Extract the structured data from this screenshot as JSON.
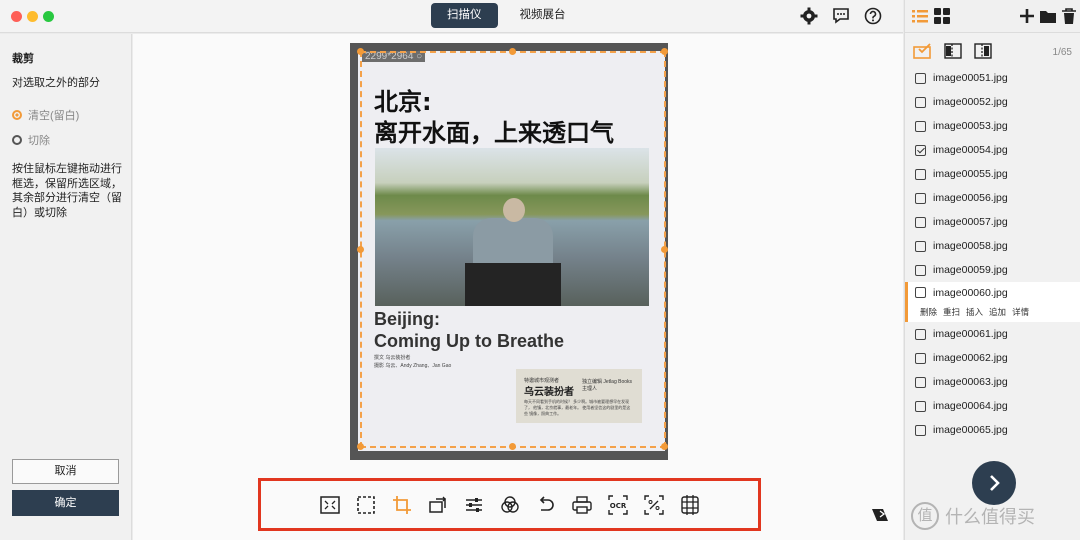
{
  "window": {
    "mode_tabs": [
      "扫描仪",
      "视频展台"
    ],
    "active_mode": 0
  },
  "toolbar_top": {
    "icons": [
      "gear-icon",
      "chat-icon",
      "help-icon"
    ]
  },
  "left_panel": {
    "title": "裁剪",
    "subtitle": "对选取之外的部分",
    "options": [
      {
        "label": "清空(留白)",
        "selected": true
      },
      {
        "label": "切除",
        "selected": false
      }
    ],
    "description": "按住鼠标左键拖动进行框选，保留所选区域，其余部分进行清空（留白）或切除",
    "cancel_label": "取消",
    "confirm_label": "确定"
  },
  "document": {
    "size_label": "2299*2964 ○",
    "headline_cn_1": "北京:",
    "headline_cn_2": "离开水面，上来透口气",
    "headline_en_1": "Beijing:",
    "headline_en_2": "Coming Up to Breathe",
    "credit_1": "撰文  乌云装扮者",
    "credit_2": "摄影  乌云、Andy Zhang、Jan Gao",
    "box_line_1": "特邀城市观测者",
    "box_name": "乌云装扮者",
    "box_side": "独立编辑 Jetlag Books 主理人",
    "box_body": "每天不同看到手机的时候？ 多少啊。城市被要理想早在发现了， 他镇，北京就事，最老年。 使用者坚信这的剧里的是这些 镜像，照典工作。"
  },
  "bottom_toolbar": {
    "tools": [
      "fit-screen-icon",
      "select-icon",
      "crop-icon",
      "rotate-icon",
      "adjust-icon",
      "color-icon",
      "undo-icon",
      "print-icon",
      "ocr-icon",
      "batch-icon",
      "grid-icon"
    ],
    "ocr_label": "OCR"
  },
  "right_panel": {
    "count": "1/65",
    "files": [
      {
        "name": "image00051.jpg",
        "checked": false
      },
      {
        "name": "image00052.jpg",
        "checked": false
      },
      {
        "name": "image00053.jpg",
        "checked": false
      },
      {
        "name": "image00054.jpg",
        "checked": true
      },
      {
        "name": "image00055.jpg",
        "checked": false
      },
      {
        "name": "image00056.jpg",
        "checked": false
      },
      {
        "name": "image00057.jpg",
        "checked": false
      },
      {
        "name": "image00058.jpg",
        "checked": false
      },
      {
        "name": "image00059.jpg",
        "checked": false
      },
      {
        "name": "image00060.jpg",
        "checked": false
      },
      {
        "name": "image00061.jpg",
        "checked": false
      },
      {
        "name": "image00062.jpg",
        "checked": false
      },
      {
        "name": "image00063.jpg",
        "checked": false
      },
      {
        "name": "image00064.jpg",
        "checked": false
      },
      {
        "name": "image00065.jpg",
        "checked": false
      }
    ],
    "selected_index": 9,
    "selected_actions": [
      "删除",
      "重扫",
      "插入",
      "追加",
      "详情"
    ],
    "watermark_text": "什么值得买",
    "watermark_mark": "值"
  },
  "colors": {
    "accent": "#f29a38",
    "primary": "#2d3e50",
    "highlight_border": "#e1361f"
  }
}
